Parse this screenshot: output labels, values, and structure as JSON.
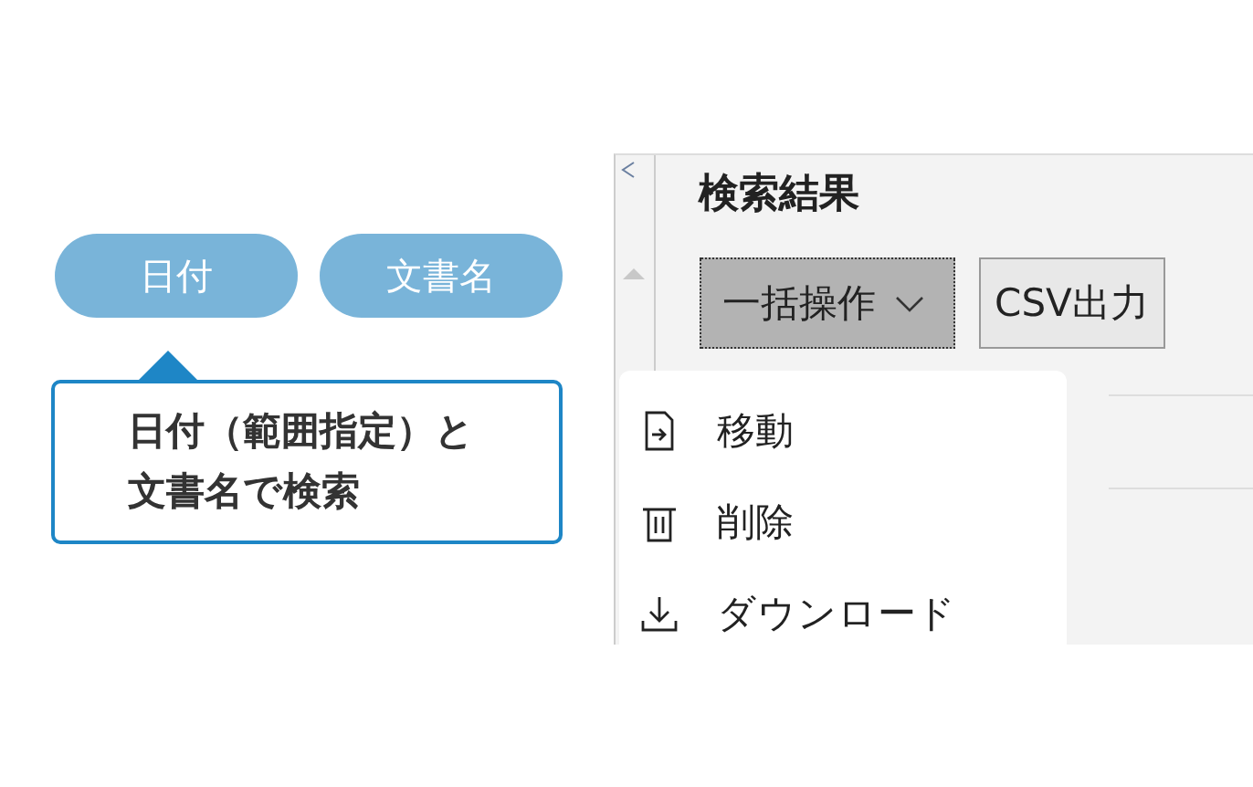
{
  "filters": [
    {
      "label": "日付"
    },
    {
      "label": "文書名"
    }
  ],
  "callout": {
    "text": "日付（範囲指定）と文書名で検索"
  },
  "results": {
    "title": "検索結果",
    "buttons": [
      {
        "label": "一括操作",
        "kind": "dropdown",
        "pressed": true
      },
      {
        "label": "CSV出力",
        "kind": "plain",
        "pressed": false
      }
    ],
    "menu": [
      {
        "label": "移動",
        "kind": "move"
      },
      {
        "label": "削除",
        "kind": "delete"
      },
      {
        "label": "ダウンロード",
        "kind": "download"
      }
    ]
  }
}
